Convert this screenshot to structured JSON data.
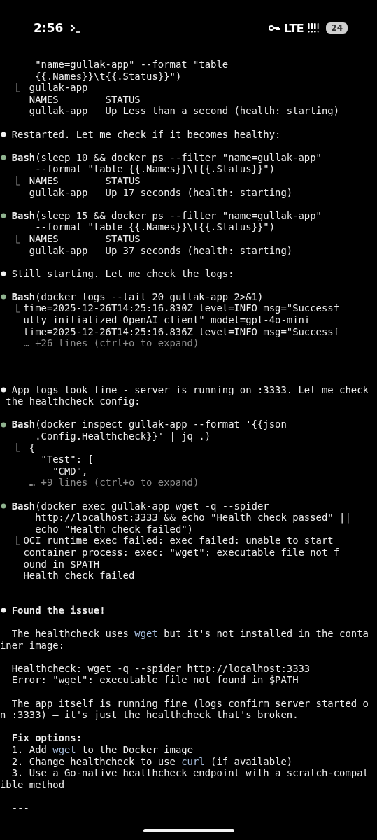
{
  "status_bar": {
    "time": "2:56",
    "network": "LTE",
    "battery": "24"
  },
  "lines": [
    {
      "kind": "cont",
      "parts": [
        {
          "text": "\"name=gullak-app\" --format \"table"
        }
      ]
    },
    {
      "kind": "cont",
      "parts": [
        {
          "text": "{{.Names}}\\t{{.Status}}\")"
        }
      ]
    },
    {
      "kind": "branch",
      "parts": [
        {
          "text": " gullak-app"
        }
      ]
    },
    {
      "kind": "output",
      "parts": [
        {
          "text": " NAMES        STATUS"
        }
      ]
    },
    {
      "kind": "output",
      "parts": [
        {
          "text": " gullak-app   Up Less than a second (health: starting)"
        }
      ]
    },
    {
      "kind": "blank"
    },
    {
      "kind": "message",
      "parts": [
        {
          "text": "Restarted. Let me check if it becomes healthy:"
        }
      ]
    },
    {
      "kind": "blank"
    },
    {
      "kind": "tool",
      "parts": [
        {
          "text": "Bash",
          "kind": "bold"
        },
        {
          "text": "(sleep 10 && docker ps --filter \"name=gullak-app\""
        }
      ]
    },
    {
      "kind": "cont",
      "parts": [
        {
          "text": "--format \"table {{.Names}}\\t{{.Status}}\")"
        }
      ]
    },
    {
      "kind": "branch",
      "parts": [
        {
          "text": " NAMES        STATUS"
        }
      ]
    },
    {
      "kind": "output",
      "parts": [
        {
          "text": " gullak-app   Up 17 seconds (health: starting)"
        }
      ]
    },
    {
      "kind": "blank"
    },
    {
      "kind": "tool",
      "parts": [
        {
          "text": "Bash",
          "kind": "bold"
        },
        {
          "text": "(sleep 15 && docker ps --filter \"name=gullak-app\""
        }
      ]
    },
    {
      "kind": "cont",
      "parts": [
        {
          "text": "--format \"table {{.Names}}\\t{{.Status}}\")"
        }
      ]
    },
    {
      "kind": "branch",
      "parts": [
        {
          "text": " NAMES        STATUS"
        }
      ]
    },
    {
      "kind": "output",
      "parts": [
        {
          "text": " gullak-app   Up 37 seconds (health: starting)"
        }
      ]
    },
    {
      "kind": "blank"
    },
    {
      "kind": "message",
      "parts": [
        {
          "text": "Still starting. Let me check the logs:"
        }
      ]
    },
    {
      "kind": "blank"
    },
    {
      "kind": "tool",
      "parts": [
        {
          "text": "Bash",
          "kind": "bold"
        },
        {
          "text": "(docker logs --tail 20 gullak-app 2>&1)"
        }
      ]
    },
    {
      "kind": "branch",
      "parts": [
        {
          "text": "time=2025-12-26T14:25:16.830Z level=INFO msg=\"Successf"
        }
      ]
    },
    {
      "kind": "output",
      "parts": [
        {
          "text": "ully initialized OpenAI client\" model=gpt-4o-mini"
        }
      ]
    },
    {
      "kind": "output",
      "parts": [
        {
          "text": "time=2025-12-26T14:25:16.836Z level=INFO msg=\"Successf"
        }
      ]
    },
    {
      "kind": "hint",
      "parts": [
        {
          "text": "… +26 lines (ctrl+o to expand)"
        }
      ]
    },
    {
      "kind": "blank"
    },
    {
      "kind": "blank"
    },
    {
      "kind": "blank"
    },
    {
      "kind": "message",
      "parts": [
        {
          "text": "App logs look fine - server is running on :3333. Let me check"
        }
      ]
    },
    {
      "kind": "plain",
      "parts": [
        {
          "text": " the healthcheck config:"
        }
      ]
    },
    {
      "kind": "blank"
    },
    {
      "kind": "tool",
      "parts": [
        {
          "text": "Bash",
          "kind": "bold"
        },
        {
          "text": "(docker inspect gullak-app --format '{{json"
        }
      ]
    },
    {
      "kind": "cont",
      "parts": [
        {
          "text": ".Config.Healthcheck}}' | jq .)"
        }
      ]
    },
    {
      "kind": "branch",
      "parts": [
        {
          "text": " {"
        }
      ]
    },
    {
      "kind": "output",
      "parts": [
        {
          "text": "   \"Test\": ["
        }
      ]
    },
    {
      "kind": "output",
      "parts": [
        {
          "text": "     \"CMD\","
        }
      ]
    },
    {
      "kind": "hint",
      "parts": [
        {
          "text": " … +9 lines (ctrl+o to expand)"
        }
      ]
    },
    {
      "kind": "blank"
    },
    {
      "kind": "tool",
      "parts": [
        {
          "text": "Bash",
          "kind": "bold"
        },
        {
          "text": "(docker exec gullak-app wget -q --spider"
        }
      ]
    },
    {
      "kind": "cont",
      "parts": [
        {
          "text": "http://localhost:3333 && echo \"Health check passed\" ||"
        }
      ]
    },
    {
      "kind": "cont",
      "parts": [
        {
          "text": "echo \"Health check failed\")"
        }
      ]
    },
    {
      "kind": "branch",
      "parts": [
        {
          "text": "OCI runtime exec failed: exec failed: unable to start"
        }
      ]
    },
    {
      "kind": "output",
      "parts": [
        {
          "text": "container process: exec: \"wget\": executable file not f"
        }
      ]
    },
    {
      "kind": "output",
      "parts": [
        {
          "text": "ound in $PATH"
        }
      ]
    },
    {
      "kind": "output",
      "parts": [
        {
          "text": "Health check failed"
        }
      ]
    },
    {
      "kind": "blank"
    },
    {
      "kind": "blank"
    },
    {
      "kind": "message",
      "parts": [
        {
          "text": "Found the issue!",
          "kind": "bold"
        }
      ]
    },
    {
      "kind": "blank"
    },
    {
      "kind": "plain",
      "parts": [
        {
          "text": "  The healthcheck uses "
        },
        {
          "text": "wget",
          "kind": "code"
        },
        {
          "text": " but it's not installed in the conta"
        }
      ]
    },
    {
      "kind": "plain",
      "parts": [
        {
          "text": "iner image:"
        }
      ]
    },
    {
      "kind": "blank"
    },
    {
      "kind": "plain",
      "parts": [
        {
          "text": "  Healthcheck: wget -q --spider http://localhost:3333"
        }
      ]
    },
    {
      "kind": "plain",
      "parts": [
        {
          "text": "  Error: \"wget\": executable file not found in $PATH"
        }
      ]
    },
    {
      "kind": "blank"
    },
    {
      "kind": "plain",
      "parts": [
        {
          "text": "  The app itself is running fine (logs confirm server started o"
        }
      ]
    },
    {
      "kind": "plain",
      "parts": [
        {
          "text": "n :3333) — it's just the healthcheck that's broken."
        }
      ]
    },
    {
      "kind": "blank"
    },
    {
      "kind": "para",
      "parts": [
        {
          "text": "Fix options:",
          "kind": "bold"
        }
      ]
    },
    {
      "kind": "plain",
      "parts": [
        {
          "text": "  1. Add "
        },
        {
          "text": "wget",
          "kind": "code"
        },
        {
          "text": " to the Docker image"
        }
      ]
    },
    {
      "kind": "plain",
      "parts": [
        {
          "text": "  2. Change healthcheck to use "
        },
        {
          "text": "curl",
          "kind": "code"
        },
        {
          "text": " (if available)"
        }
      ]
    },
    {
      "kind": "plain",
      "parts": [
        {
          "text": "  3. Use a Go-native healthcheck endpoint with a scratch-compat"
        }
      ]
    },
    {
      "kind": "plain",
      "parts": [
        {
          "text": "ible method"
        }
      ]
    },
    {
      "kind": "blank"
    },
    {
      "kind": "plain",
      "parts": [
        {
          "text": "  ---"
        }
      ]
    }
  ]
}
